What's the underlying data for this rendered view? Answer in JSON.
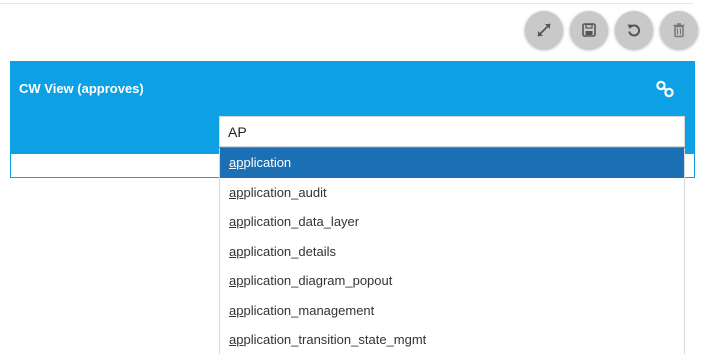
{
  "toolbar": {
    "buttons": [
      {
        "icon": "expand-icon"
      },
      {
        "icon": "save-icon"
      },
      {
        "icon": "undo-icon"
      },
      {
        "icon": "trash-icon"
      }
    ]
  },
  "panel": {
    "title": "CW View (approves)",
    "header_color": "#0ea0e4",
    "action_icon": "link-icon"
  },
  "search": {
    "value": "AP"
  },
  "dropdown": {
    "selected_color": "#1a6fb5",
    "items": [
      {
        "match": "ap",
        "rest": "plication",
        "selected": true
      },
      {
        "match": "ap",
        "rest": "plication_audit",
        "selected": false
      },
      {
        "match": "ap",
        "rest": "plication_data_layer",
        "selected": false
      },
      {
        "match": "ap",
        "rest": "plication_details",
        "selected": false
      },
      {
        "match": "ap",
        "rest": "plication_diagram_popout",
        "selected": false
      },
      {
        "match": "ap",
        "rest": "plication_management",
        "selected": false
      },
      {
        "match": "ap",
        "rest": "plication_transition_state_mgmt",
        "selected": false
      }
    ]
  }
}
